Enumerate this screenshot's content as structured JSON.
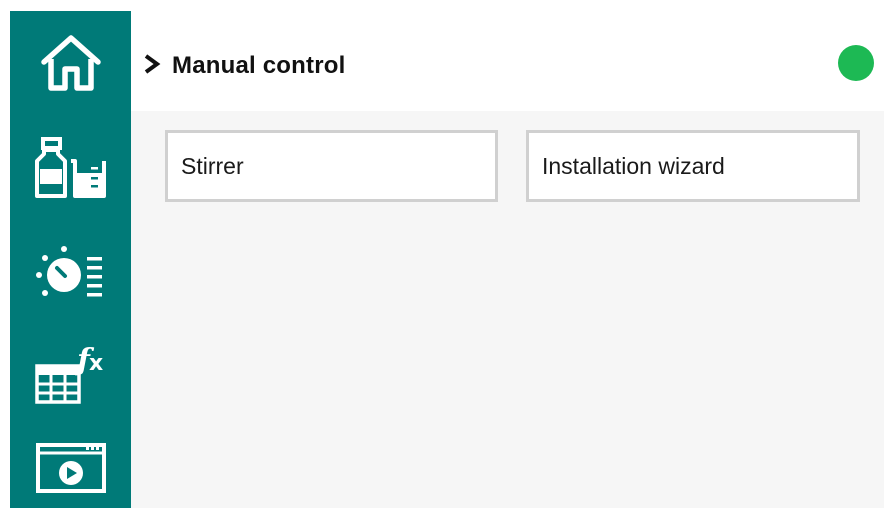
{
  "colors": {
    "sidebar": "#007a78",
    "status": "#1db954",
    "main_background": "#f6f6f6",
    "tile_border": "#d0d0d0"
  },
  "sidebar": {
    "items": [
      {
        "icon": "home-icon"
      },
      {
        "icon": "bottle-beaker-icon"
      },
      {
        "icon": "dial-settings-icon"
      },
      {
        "icon": "table-formula-icon"
      },
      {
        "icon": "video-player-icon"
      }
    ]
  },
  "header": {
    "breadcrumb_icon": "chevron-right-icon",
    "title": "Manual control",
    "status": "green"
  },
  "main": {
    "tiles": [
      {
        "label": "Stirrer"
      },
      {
        "label": "Installation wizard"
      }
    ]
  }
}
